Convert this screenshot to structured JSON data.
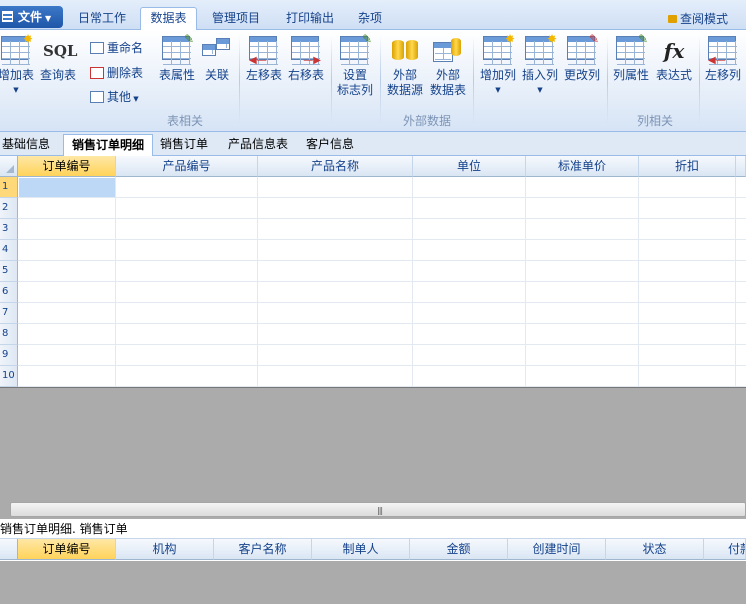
{
  "menu": {
    "file_label": "文件",
    "tabs": [
      {
        "label": "日常工作"
      },
      {
        "label": "数据表"
      },
      {
        "label": "管理项目"
      },
      {
        "label": "打印输出"
      },
      {
        "label": "杂项"
      }
    ],
    "active_tab": "数据表",
    "view_mode_label": "查阅模式"
  },
  "ribbon": {
    "add_table": "增加表",
    "query_table_icon": "SQL",
    "query_table": "查询表",
    "rename": "重命名",
    "delete_table": "删除表",
    "other": "其他",
    "table_props": "表属性",
    "relation": "关联",
    "move_left": "左移表",
    "move_right": "右移表",
    "set_flag_col_1": "设置",
    "set_flag_col_2": "标志列",
    "ext_source_1": "外部",
    "ext_source_2": "数据源",
    "ext_table_1": "外部",
    "ext_table_2": "数据表",
    "add_col": "增加列",
    "insert_col": "插入列",
    "modify_col": "更改列",
    "col_props": "列属性",
    "expression_icon": "fx",
    "expression": "表达式",
    "move_col_left": "左移列",
    "group_table": "表相关",
    "group_external": "外部数据",
    "group_column": "列相关"
  },
  "table_tabs": [
    {
      "label": "基础信息"
    },
    {
      "label": "销售订单明细"
    },
    {
      "label": "产品信息表"
    },
    {
      "label": "客户信息"
    }
  ],
  "table_tab_extra": "销售订单",
  "active_table_tab": "销售订单明细",
  "grid1": {
    "columns": [
      "订单编号",
      "产品编号",
      "产品名称",
      "单位",
      "标准单价",
      "折扣"
    ],
    "row_numbers": [
      "1",
      "2",
      "3",
      "4",
      "5",
      "6",
      "7",
      "8",
      "9",
      "10"
    ]
  },
  "caption2": "销售订单明细. 销售订单",
  "grid2": {
    "columns": [
      "订单编号",
      "机构",
      "客户名称",
      "制单人",
      "金额",
      "创建时间",
      "状态",
      "付款"
    ]
  },
  "colors": {
    "selected_header": "#ffd35a",
    "selected_cell": "#bcd8f6",
    "workspace_gray": "#ababab"
  }
}
